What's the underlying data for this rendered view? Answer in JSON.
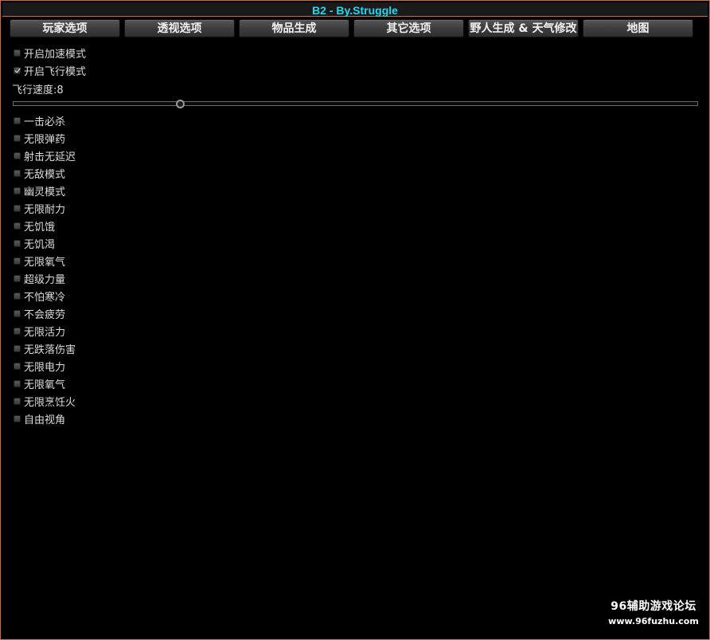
{
  "window": {
    "title": "B2 - By.Struggle"
  },
  "tabs": [
    {
      "label": "玩家选项"
    },
    {
      "label": "透视选项"
    },
    {
      "label": "物品生成"
    },
    {
      "label": "其它选项"
    },
    {
      "label": "野人生成 & 天气修改"
    },
    {
      "label": "地图"
    }
  ],
  "options_top": [
    {
      "label": "开启加速模式",
      "checked": false
    },
    {
      "label": "开启飞行模式",
      "checked": true
    }
  ],
  "fly_speed": {
    "label": "飞行速度:8",
    "value": 8
  },
  "options": [
    {
      "label": "一击必杀",
      "checked": false
    },
    {
      "label": "无限弹药",
      "checked": false
    },
    {
      "label": "射击无延迟",
      "checked": false
    },
    {
      "label": "无敌模式",
      "checked": false
    },
    {
      "label": "幽灵模式",
      "checked": false
    },
    {
      "label": "无限耐力",
      "checked": false
    },
    {
      "label": "无饥饿",
      "checked": false
    },
    {
      "label": "无饥渴",
      "checked": false
    },
    {
      "label": "无限氧气",
      "checked": false
    },
    {
      "label": "超级力量",
      "checked": false
    },
    {
      "label": "不怕寒冷",
      "checked": false
    },
    {
      "label": "不会疲劳",
      "checked": false
    },
    {
      "label": "无限活力",
      "checked": false
    },
    {
      "label": "无跌落伤害",
      "checked": false
    },
    {
      "label": "无限电力",
      "checked": false
    },
    {
      "label": "无限氧气",
      "checked": false
    },
    {
      "label": "无限烹饪火",
      "checked": false
    },
    {
      "label": "自由视角",
      "checked": false
    }
  ],
  "watermark": {
    "title": "96辅助游戏论坛",
    "url": "www.96fuzhu.com"
  },
  "colors": {
    "border_accent": "#c8703a",
    "title_text": "#22d8f0",
    "background": "#000000"
  }
}
